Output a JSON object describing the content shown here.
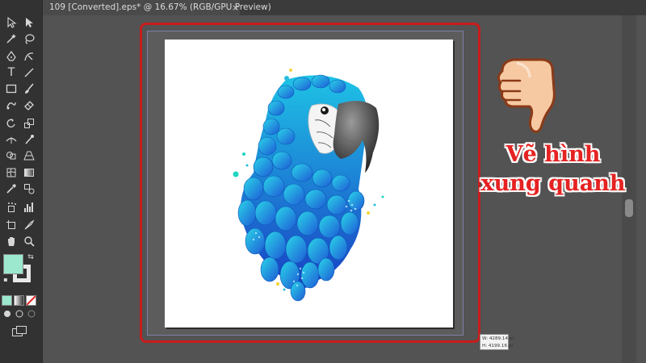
{
  "document_tab": {
    "title": "109 [Converted].eps* @ 16.67% (RGB/GPU Preview)",
    "close_glyph": "×"
  },
  "toolbar": {
    "tools": [
      "selection-tool",
      "direct-selection-tool",
      "magic-wand-tool",
      "lasso-tool",
      "pen-tool",
      "curvature-tool",
      "type-tool",
      "line-segment-tool",
      "rectangle-tool",
      "paintbrush-tool",
      "shaper-tool",
      "eraser-tool",
      "rotate-tool",
      "scale-tool",
      "width-tool",
      "puppet-warp-tool",
      "shape-builder-tool",
      "perspective-grid-tool",
      "mesh-tool",
      "gradient-tool",
      "eyedropper-tool",
      "blend-tool",
      "symbol-sprayer-tool",
      "column-graph-tool",
      "artboard-tool",
      "slice-tool",
      "hand-tool",
      "zoom-tool"
    ],
    "type_tool_glyph": "T",
    "fill_color": "#9be8cf",
    "stroke_color": "#e8e8e8"
  },
  "artboard": {
    "size_tooltip_w": "W: 4289.14 pt",
    "size_tooltip_h": "H: 4199.16 pt"
  },
  "annotation": {
    "line1": "Vẽ hình",
    "line2": "xung quanh",
    "color": "#e52222",
    "highlight_color": "#c81c1c"
  }
}
